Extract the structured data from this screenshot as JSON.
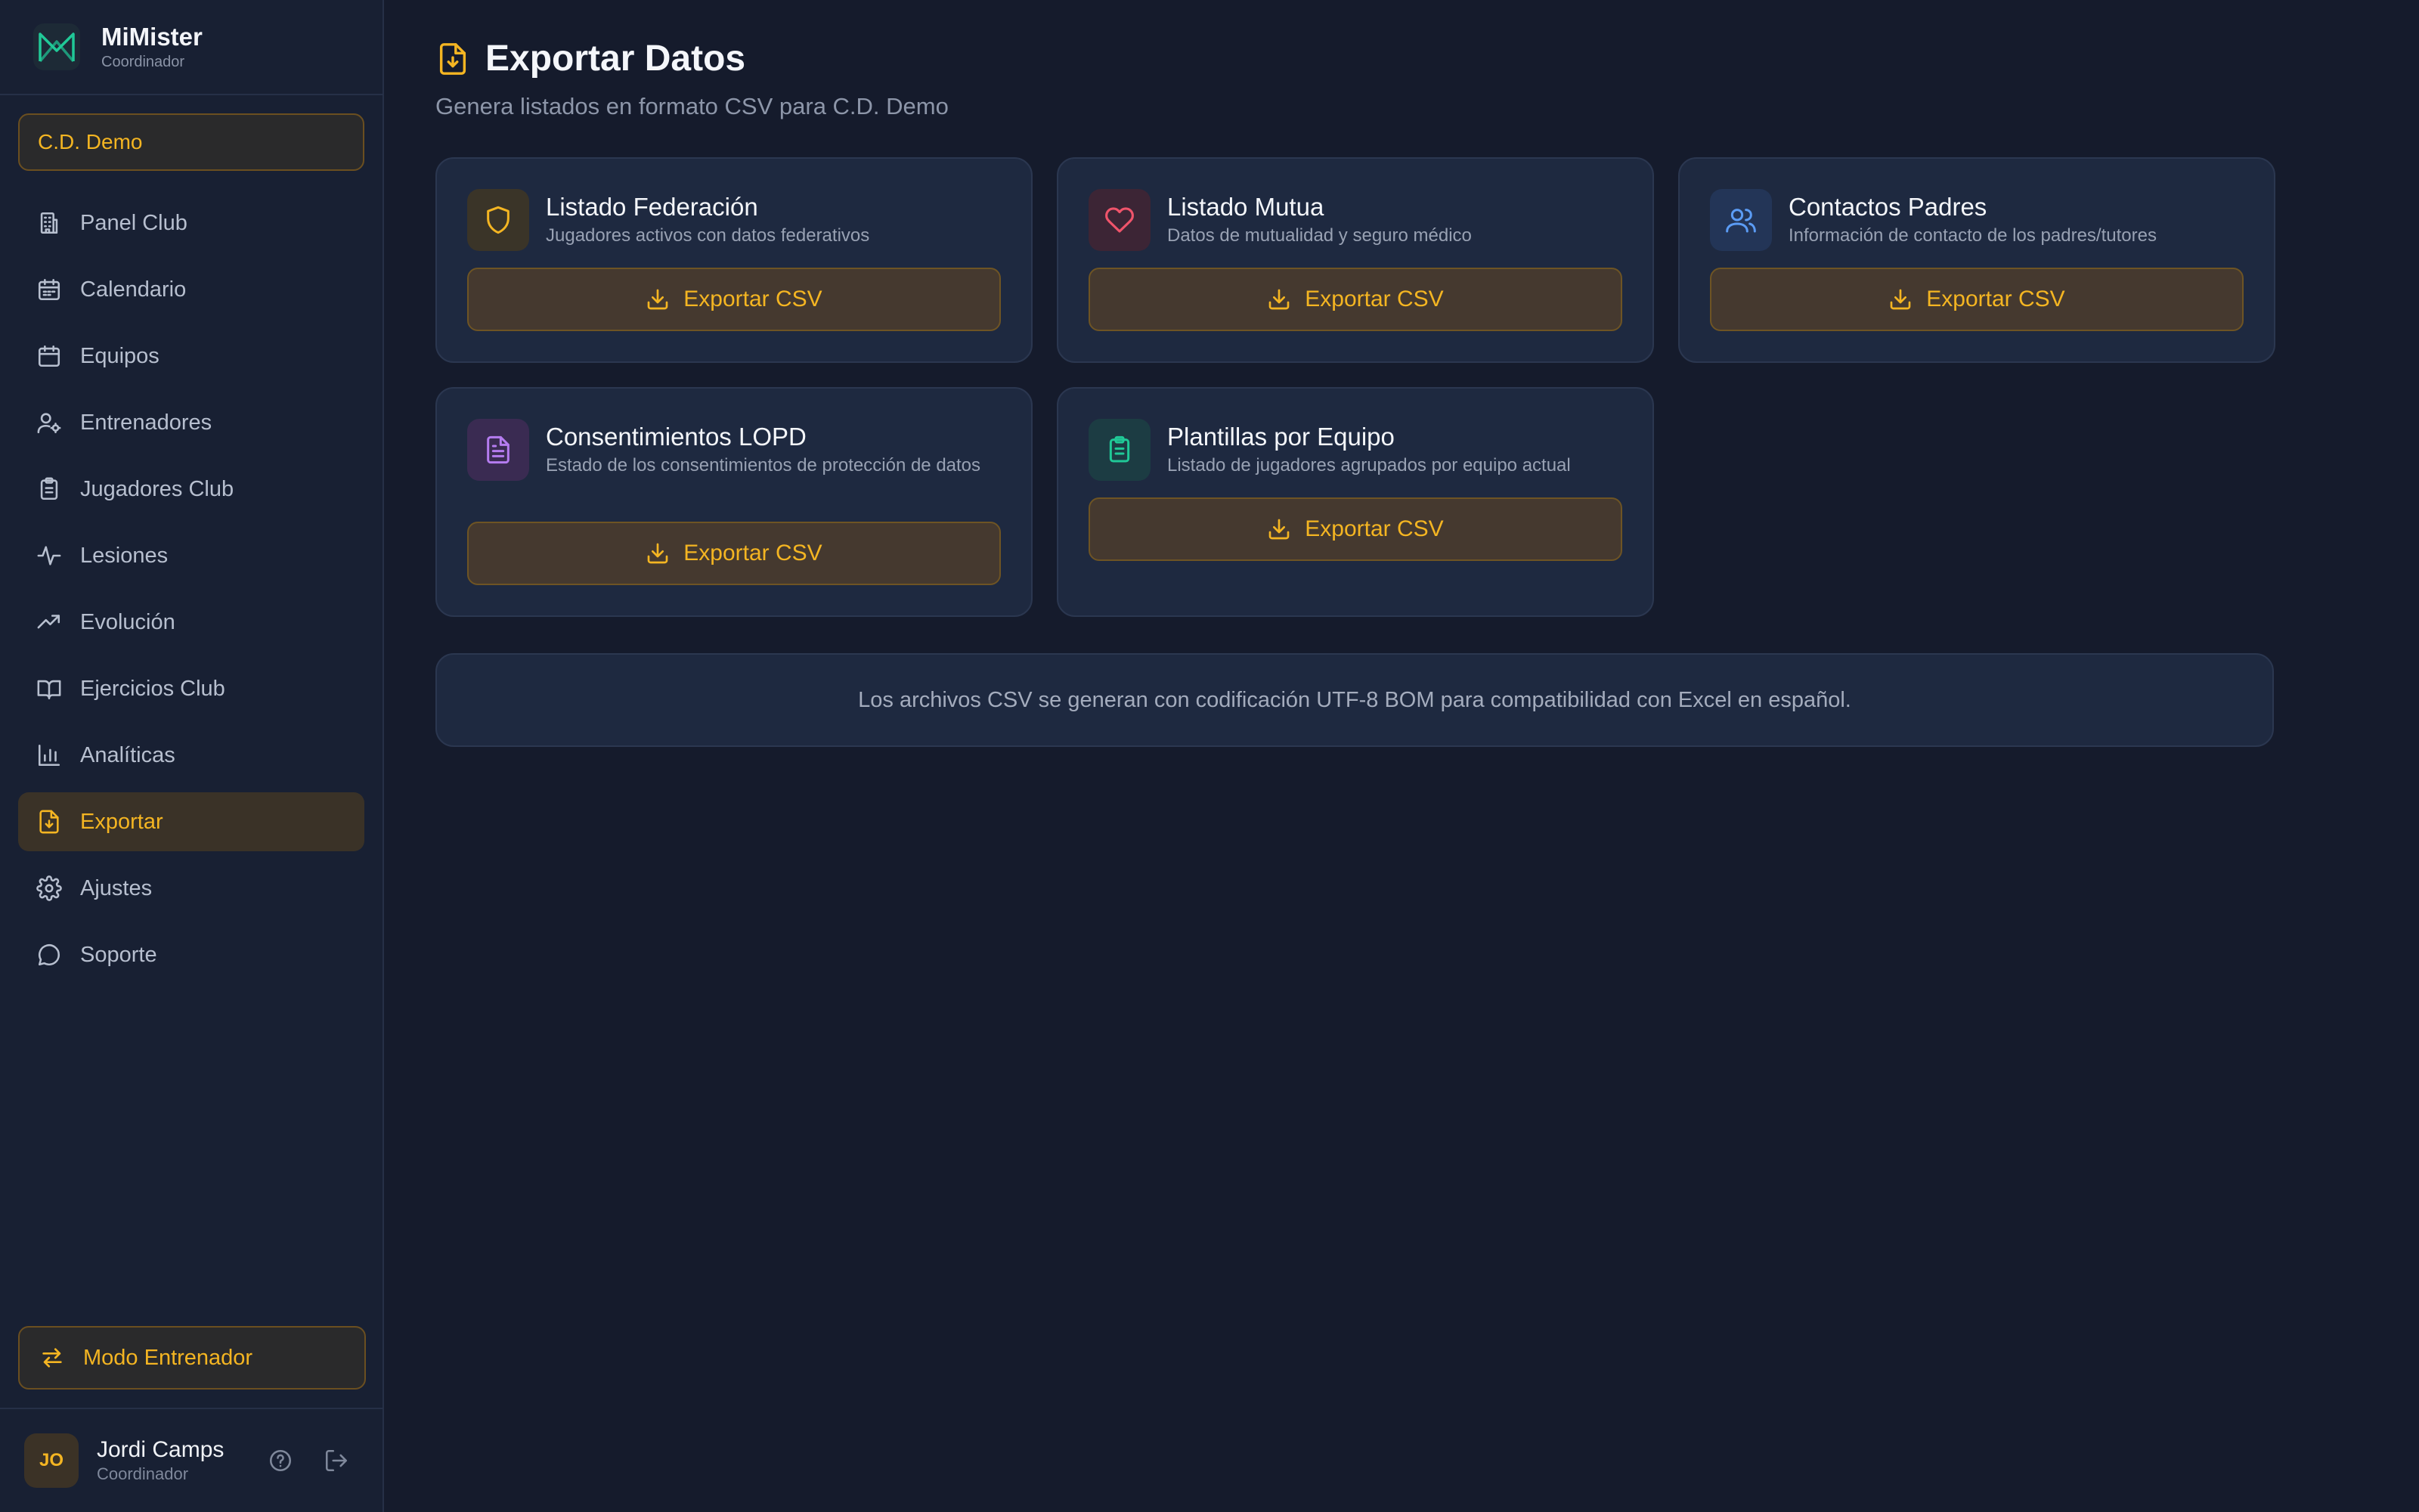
{
  "brand": {
    "name": "MiMister",
    "role": "Coordinador"
  },
  "club": {
    "selected": "C.D. Demo"
  },
  "nav": [
    {
      "label": "Panel Club",
      "icon": "building-icon"
    },
    {
      "label": "Calendario",
      "icon": "calendar-icon"
    },
    {
      "label": "Equipos",
      "icon": "calendar-icon"
    },
    {
      "label": "Entrenadores",
      "icon": "user-gear-icon"
    },
    {
      "label": "Jugadores Club",
      "icon": "clipboard-icon"
    },
    {
      "label": "Lesiones",
      "icon": "activity-icon"
    },
    {
      "label": "Evolución",
      "icon": "trending-up-icon"
    },
    {
      "label": "Ejercicios Club",
      "icon": "book-icon"
    },
    {
      "label": "Analíticas",
      "icon": "bar-chart-icon"
    },
    {
      "label": "Exportar",
      "icon": "file-download-icon",
      "active": true
    },
    {
      "label": "Ajustes",
      "icon": "gear-icon"
    },
    {
      "label": "Soporte",
      "icon": "chat-icon"
    }
  ],
  "mode_button": {
    "label": "Modo Entrenador"
  },
  "user": {
    "initials": "JO",
    "name": "Jordi Camps",
    "role": "Coordinador"
  },
  "page": {
    "title": "Exportar Datos",
    "subtitle": "Genera listados en formato CSV para C.D. Demo"
  },
  "cards": [
    {
      "title": "Listado Federación",
      "description": "Jugadores activos con datos federativos",
      "button": "Exportar CSV",
      "icon": "shield-icon",
      "color": "#f4b522"
    },
    {
      "title": "Listado Mutua",
      "description": "Datos de mutualidad y seguro médico",
      "button": "Exportar CSV",
      "icon": "heart-icon",
      "color": "#f0546b"
    },
    {
      "title": "Contactos Padres",
      "description": "Información de contacto de los padres/tutores",
      "button": "Exportar CSV",
      "icon": "users-icon",
      "color": "#5b9cf5"
    },
    {
      "title": "Consentimientos LOPD",
      "description": "Estado de los consentimientos de protección de datos",
      "button": "Exportar CSV",
      "icon": "document-icon",
      "color": "#b57cf0"
    },
    {
      "title": "Plantillas por Equipo",
      "description": "Listado de jugadores agrupados por equipo actual",
      "button": "Exportar CSV",
      "icon": "clipboard-icon",
      "color": "#20c997"
    }
  ],
  "note": "Los archivos CSV se generan con codificación UTF-8 BOM para compatibilidad con Excel en español.",
  "colors": {
    "accent": "#f4b522",
    "background": "#151b2c",
    "card": "#1e2940"
  }
}
